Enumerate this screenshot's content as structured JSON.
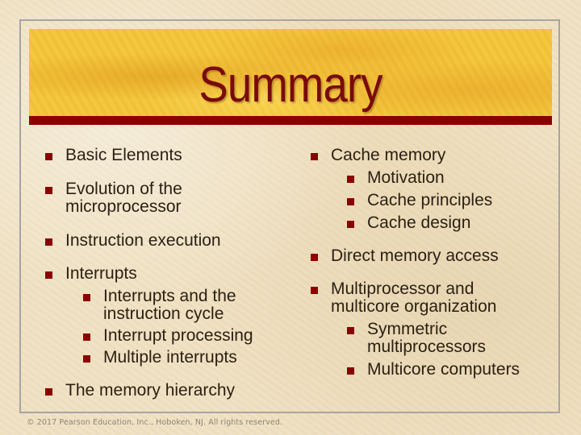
{
  "slide": {
    "title": "Summary",
    "accent_color": "#8b0000",
    "left_column": [
      {
        "label": "Basic Elements",
        "subitems": []
      },
      {
        "label": "Evolution of the microprocessor",
        "subitems": []
      },
      {
        "label": "Instruction execution",
        "subitems": []
      },
      {
        "label": "Interrupts",
        "subitems": [
          "Interrupts and the instruction cycle",
          "Interrupt processing",
          "Multiple interrupts"
        ]
      },
      {
        "label": "The memory hierarchy",
        "subitems": []
      }
    ],
    "right_column": [
      {
        "label": "Cache memory",
        "subitems": [
          "Motivation",
          "Cache principles",
          "Cache design"
        ]
      },
      {
        "label": "Direct memory access",
        "subitems": []
      },
      {
        "label": "Multiprocessor and multicore organization",
        "subitems": [
          "Symmetric multiprocessors",
          "Multicore computers"
        ]
      }
    ],
    "footer": "© 2017 Pearson Education, Inc., Hoboken, NJ. All rights reserved."
  }
}
